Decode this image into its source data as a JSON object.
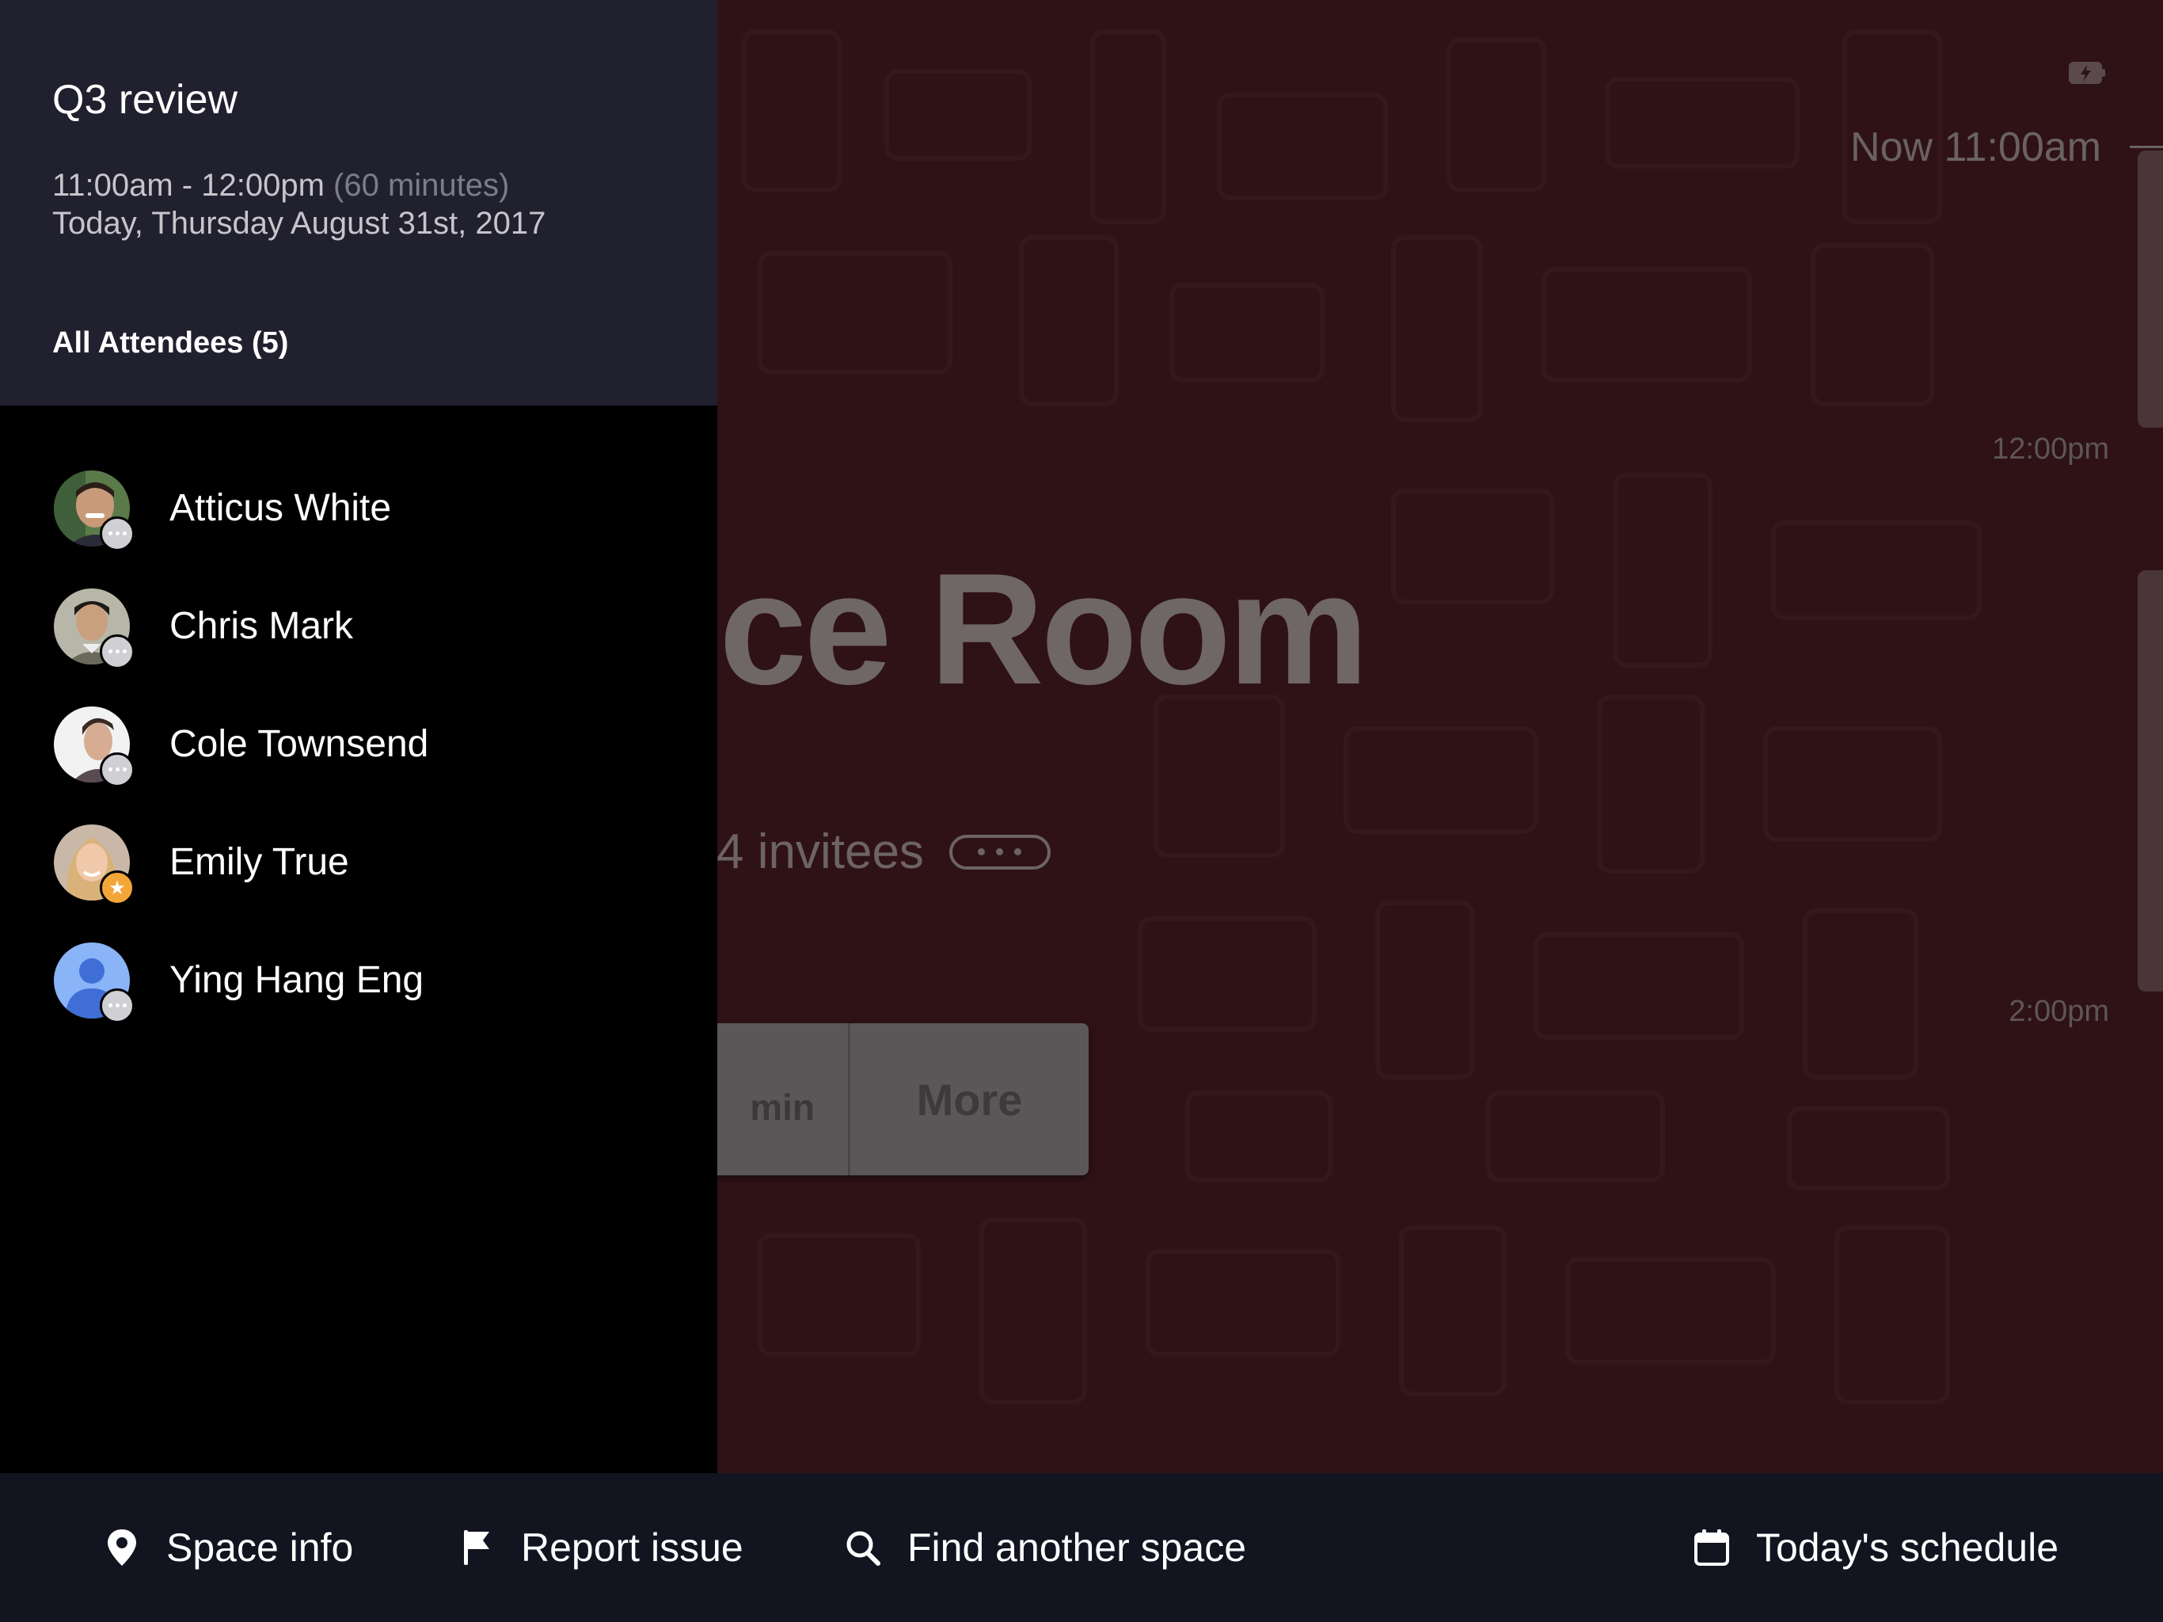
{
  "room": {
    "name_partial": "nce Room",
    "invitees_text": "4 invitees",
    "extend_min_label": "min",
    "more_label": "More"
  },
  "timeline": {
    "now_label": "Now 11:00am",
    "time_labels": [
      "12:00pm",
      "2:00pm"
    ]
  },
  "meeting": {
    "title": "Q3 review",
    "time_range": "11:00am - 12:00pm",
    "duration": "(60 minutes)",
    "date": "Today, Thursday August 31st, 2017",
    "attendees_heading": "All Attendees (5)"
  },
  "attendees": [
    {
      "name": "Atticus White",
      "status": "more",
      "avatar_icon": "person-photo"
    },
    {
      "name": "Chris Mark",
      "status": "more",
      "avatar_icon": "person-photo"
    },
    {
      "name": "Cole Townsend",
      "status": "more",
      "avatar_icon": "person-photo"
    },
    {
      "name": "Emily True",
      "status": "organizer-star",
      "avatar_icon": "person-photo"
    },
    {
      "name": "Ying Hang Eng",
      "status": "more",
      "avatar_icon": "default-person-icon"
    }
  ],
  "bottom_bar": {
    "space_info": {
      "label": "Space info",
      "icon": "location-pin-icon"
    },
    "report_issue": {
      "label": "Report issue",
      "icon": "flag-icon"
    },
    "find_space": {
      "label": "Find another space",
      "icon": "search-icon"
    },
    "schedule": {
      "label": "Today's schedule",
      "icon": "calendar-icon"
    }
  },
  "colors": {
    "room_background": "#2f1216",
    "panel_header": "#21202f",
    "bottom_bar": "#121420",
    "organizer_badge": "#f3a638"
  }
}
